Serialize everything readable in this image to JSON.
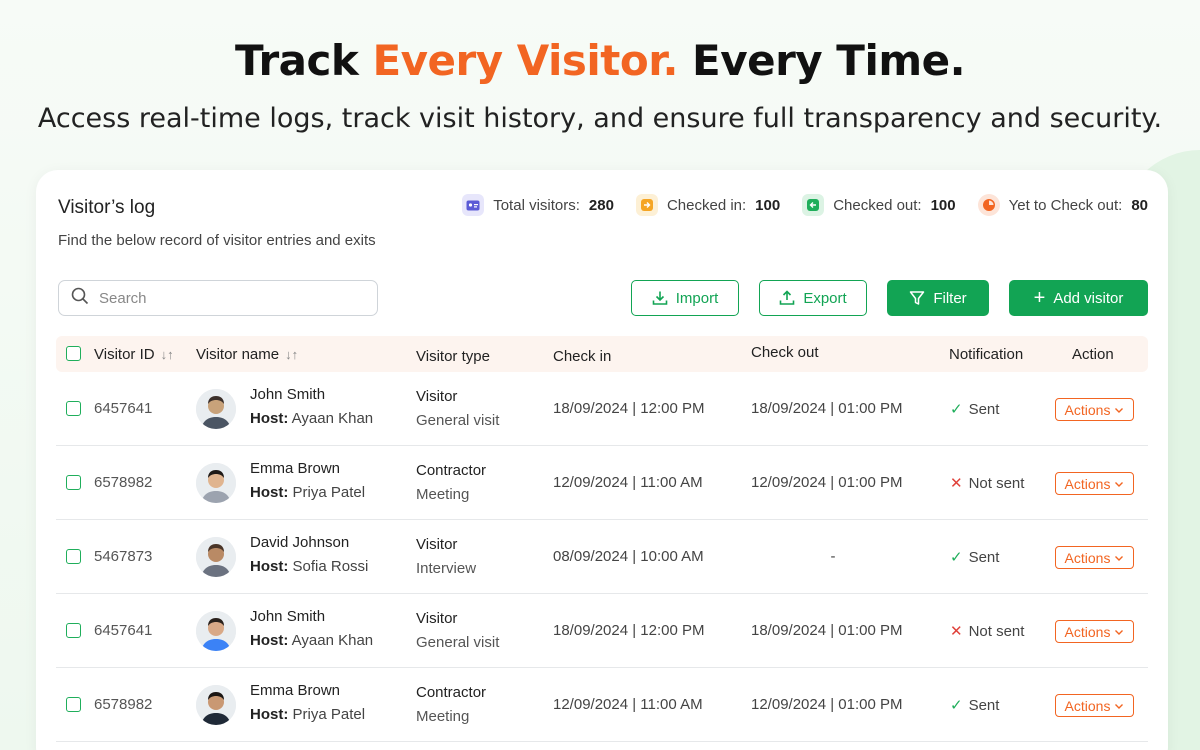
{
  "hero": {
    "title_pre": "Track ",
    "title_accent": "Every Visitor.",
    "title_post": " Every Time.",
    "subtitle": "Access real-time logs, track visit history, and ensure full transparency and security."
  },
  "card": {
    "title": "Visitor’s log",
    "subtitle": "Find the below record of visitor entries and exits"
  },
  "stats": [
    {
      "label": "Total visitors:",
      "value": "280",
      "icon": "id-card-icon",
      "color": "#5b5bd6",
      "bg": "#e7e6fb"
    },
    {
      "label": "Checked in:",
      "value": "100",
      "icon": "check-in-icon",
      "color": "#f5a524",
      "bg": "#fdf0d5"
    },
    {
      "label": "Checked out:",
      "value": "100",
      "icon": "check-out-icon",
      "color": "#1fae5b",
      "bg": "#dcf3e4"
    },
    {
      "label": "Yet to Check out:",
      "value": "80",
      "icon": "pie-clock-icon",
      "color": "#f26522",
      "bg": "#fde4d8"
    }
  ],
  "search": {
    "placeholder": "Search"
  },
  "toolbar": {
    "import_label": "Import",
    "export_label": "Export",
    "filter_label": "Filter",
    "add_label": "Add visitor"
  },
  "columns": {
    "id": "Visitor ID",
    "name": "Visitor name",
    "type": "Visitor type",
    "checkin": "Check in",
    "checkout": "Check out",
    "notification": "Notification",
    "action": "Action"
  },
  "host_prefix": "Host:",
  "actions_label": "Actions",
  "rows": [
    {
      "id": "6457641",
      "name": "John Smith",
      "host": "Ayaan Khan",
      "type": "Visitor",
      "purpose": "General visit",
      "checkin": "18/09/2024 | 12:00 PM",
      "checkout": "18/09/2024 | 01:00 PM",
      "notification": "Sent",
      "sent": true
    },
    {
      "id": "6578982",
      "name": "Emma Brown",
      "host": "Priya Patel",
      "type": "Contractor",
      "purpose": "Meeting",
      "checkin": "12/09/2024 | 11:00 AM",
      "checkout": "12/09/2024 | 01:00 PM",
      "notification": "Not sent",
      "sent": false
    },
    {
      "id": "5467873",
      "name": "David Johnson",
      "host": "Sofia Rossi",
      "type": "Visitor",
      "purpose": "Interview",
      "checkin": "08/09/2024 | 10:00 AM",
      "checkout": "-",
      "notification": "Sent",
      "sent": true
    },
    {
      "id": "6457641",
      "name": "John Smith",
      "host": "Ayaan Khan",
      "type": "Visitor",
      "purpose": "General visit",
      "checkin": "18/09/2024 | 12:00 PM",
      "checkout": "18/09/2024 | 01:00 PM",
      "notification": "Not sent",
      "sent": false
    },
    {
      "id": "6578982",
      "name": "Emma Brown",
      "host": "Priya Patel",
      "type": "Contractor",
      "purpose": "Meeting",
      "checkin": "12/09/2024 | 11:00 AM",
      "checkout": "12/09/2024 | 01:00 PM",
      "notification": "Sent",
      "sent": true
    }
  ]
}
